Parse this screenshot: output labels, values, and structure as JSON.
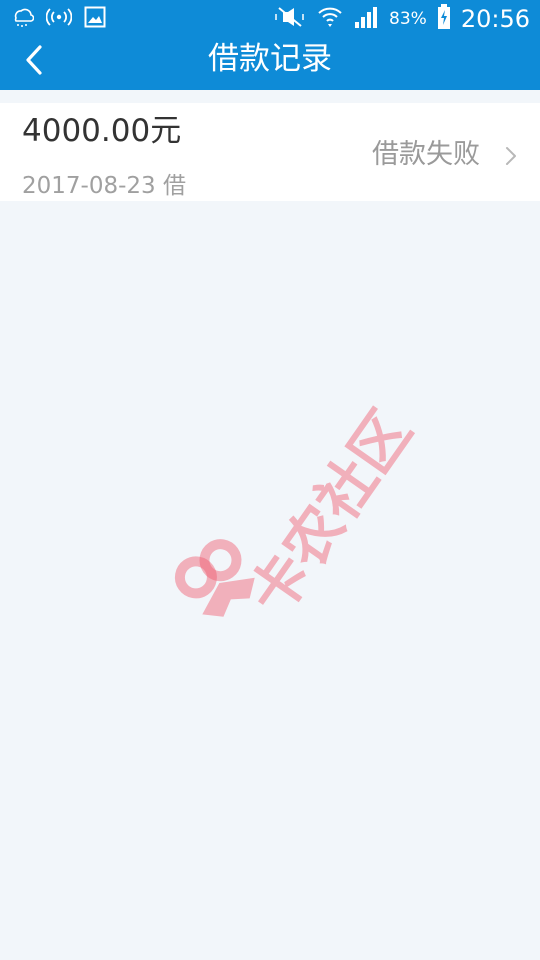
{
  "status_bar": {
    "battery_percent": "83%",
    "time": "20:56",
    "icons_left": [
      "weather-icon",
      "wireless-icon",
      "gallery-icon"
    ],
    "icons_right": [
      "mute-icon",
      "wifi-icon",
      "signal-icon",
      "battery-charging-icon"
    ]
  },
  "header": {
    "title": "借款记录",
    "back_icon": "chevron-left-icon"
  },
  "records": [
    {
      "amount": "4000.00元",
      "date": "2017-08-23 借",
      "status": "借款失败"
    }
  ],
  "watermark": {
    "text": "卡农社区"
  },
  "colors": {
    "header_bg": "#0e8bd7",
    "page_bg": "#f2f6fa",
    "watermark": "#f05a6e"
  }
}
